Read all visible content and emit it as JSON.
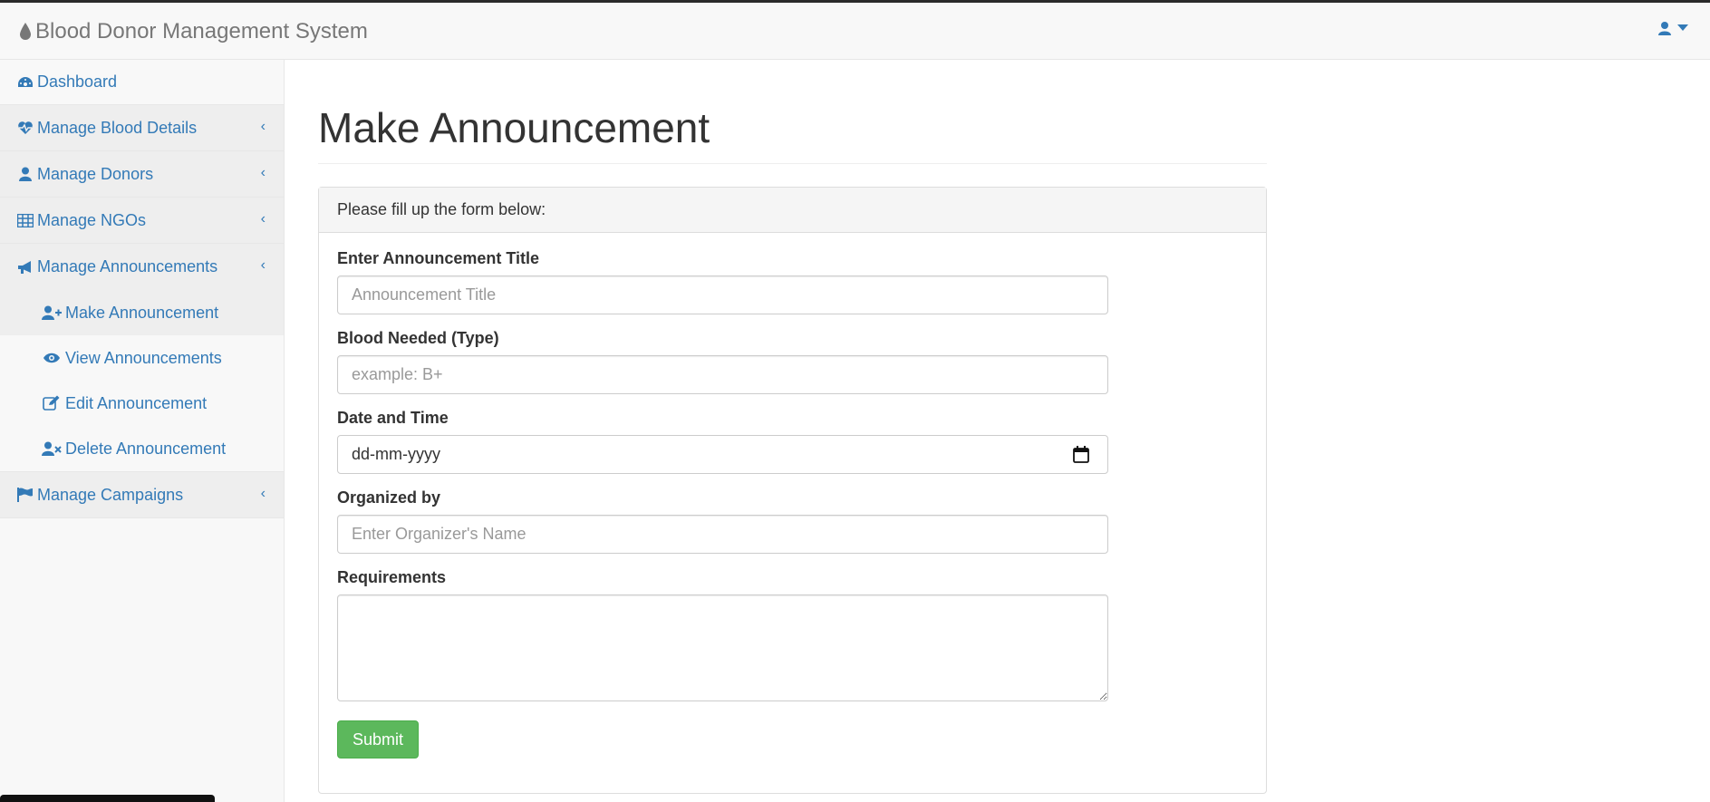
{
  "app": {
    "brand_title": "Blood Donor Management System",
    "brand_icon": "blood-drop-icon",
    "user_icon": "user-icon"
  },
  "sidebar": {
    "items": [
      {
        "label": "Dashboard",
        "icon": "dashboard-icon"
      },
      {
        "label": "Manage Blood Details",
        "icon": "heartbeat-icon"
      },
      {
        "label": "Manage Donors",
        "icon": "user-icon"
      },
      {
        "label": "Manage NGOs",
        "icon": "table-icon"
      },
      {
        "label": "Manage Announcements",
        "icon": "bullhorn-icon"
      },
      {
        "label": "Manage Campaigns",
        "icon": "flag-icon"
      }
    ],
    "sub_items": [
      {
        "label": "Make Announcement",
        "icon": "user-plus-icon"
      },
      {
        "label": "View Announcements",
        "icon": "eye-icon"
      },
      {
        "label": "Edit Announcement",
        "icon": "edit-icon"
      },
      {
        "label": "Delete Announcement",
        "icon": "user-times-icon"
      }
    ],
    "chevron": "‹"
  },
  "main": {
    "page_title": "Make Announcement",
    "panel_heading": "Please fill up the form below:",
    "fields": {
      "title": {
        "label": "Enter Announcement Title",
        "placeholder": "Announcement Title",
        "value": ""
      },
      "blood": {
        "label": "Blood Needed (Type)",
        "placeholder": "example: B+",
        "value": ""
      },
      "date": {
        "label": "Date and Time",
        "value": "dd-mm-yyyy"
      },
      "organizer": {
        "label": "Organized by",
        "placeholder": "Enter Organizer's Name",
        "value": ""
      },
      "requirements": {
        "label": "Requirements",
        "value": ""
      }
    },
    "submit_label": "Submit"
  },
  "colors": {
    "link": "#337ab7",
    "submit": "#5cb85c",
    "sidebar_bg": "#f8f8f8",
    "active_bg": "#eeeeee"
  }
}
